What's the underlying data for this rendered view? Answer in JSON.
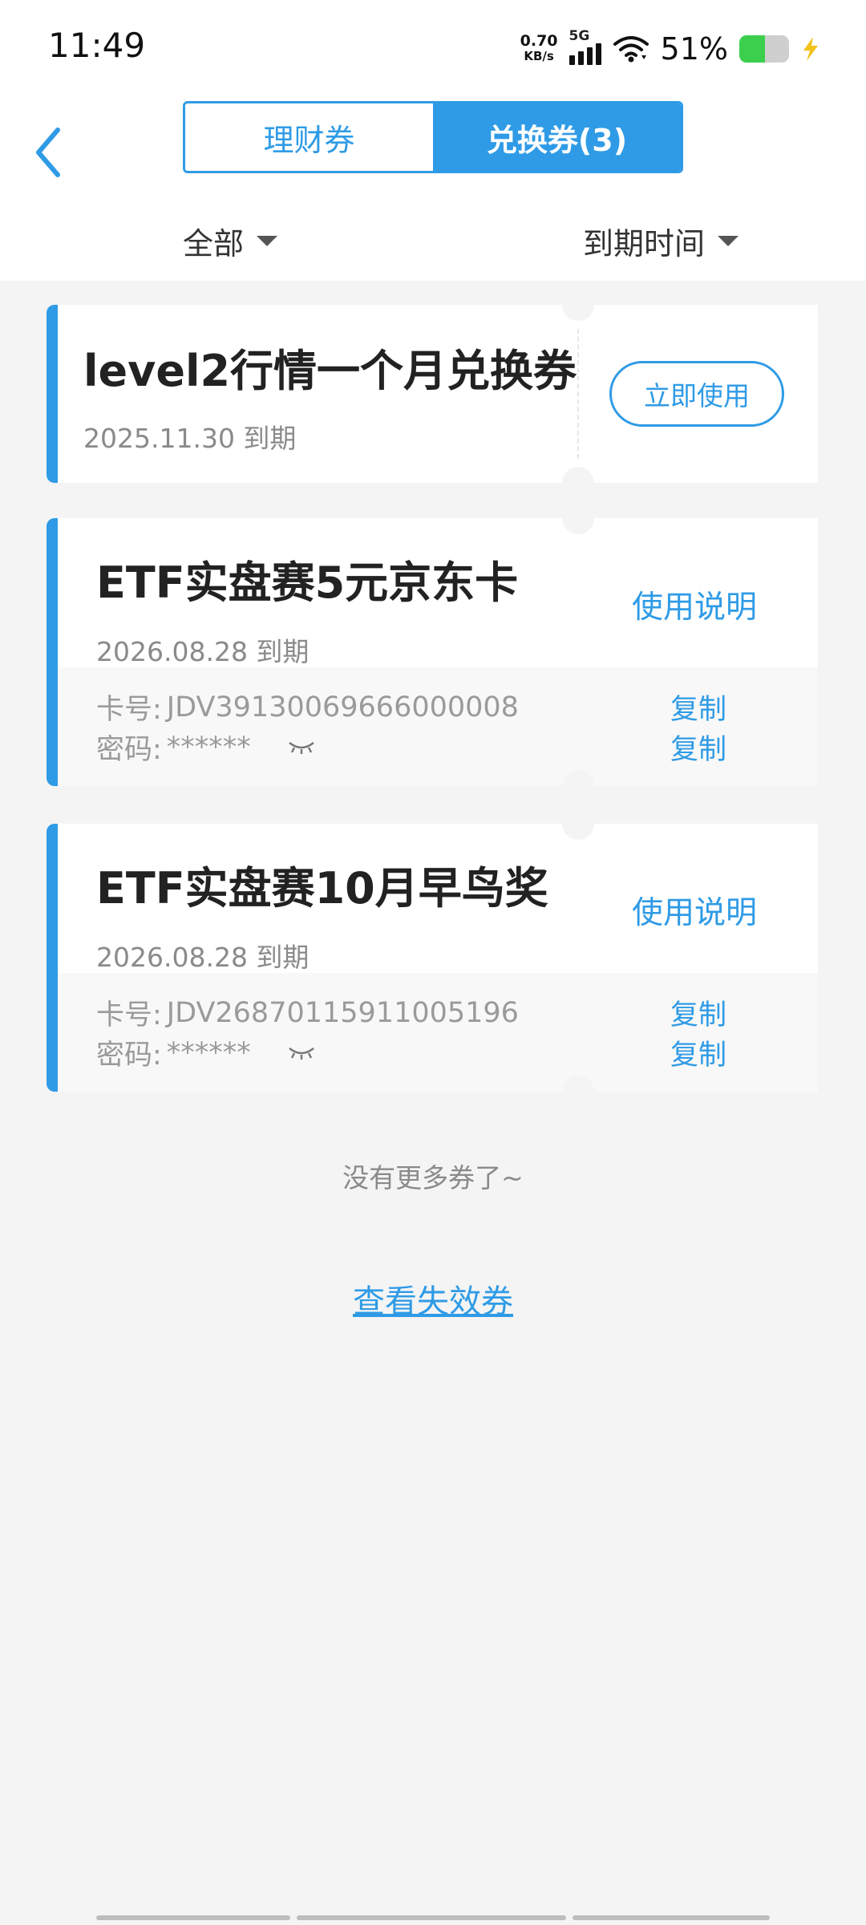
{
  "status_bar": {
    "time": "11:49",
    "net_speed_value": "0.70",
    "net_speed_unit": "KB/s",
    "network_type": "5G",
    "battery_percent": "51%",
    "battery_level": 0.51,
    "battery_color": "#3ccf4e"
  },
  "header": {
    "back_icon": "chevron-left-icon",
    "tabs": [
      {
        "label": "理财券",
        "active": false
      },
      {
        "label": "兑换券(3)",
        "active": true
      }
    ],
    "filter_all": "全部",
    "filter_sort": "到期时间"
  },
  "accent_color": "#2f9be6",
  "coupons": [
    {
      "title": "level2行情一个月兑换券",
      "expiry": "2025.11.30 到期",
      "action": "立即使用"
    },
    {
      "title": "ETF实盘赛5元京东卡",
      "expiry": "2026.08.28 到期",
      "instructions": "使用说明",
      "card_label": "卡号:",
      "card_number": "JDV39130069666000008",
      "password_label": "密码:",
      "password": "******",
      "copy_label": "复制"
    },
    {
      "title": "ETF实盘赛10月早鸟奖",
      "expiry": "2026.08.28 到期",
      "instructions": "使用说明",
      "card_label": "卡号:",
      "card_number": "JDV26870115911005196",
      "password_label": "密码:",
      "password": "******",
      "copy_label": "复制"
    }
  ],
  "no_more_text": "没有更多券了~",
  "view_invalid_text": "查看失效券"
}
